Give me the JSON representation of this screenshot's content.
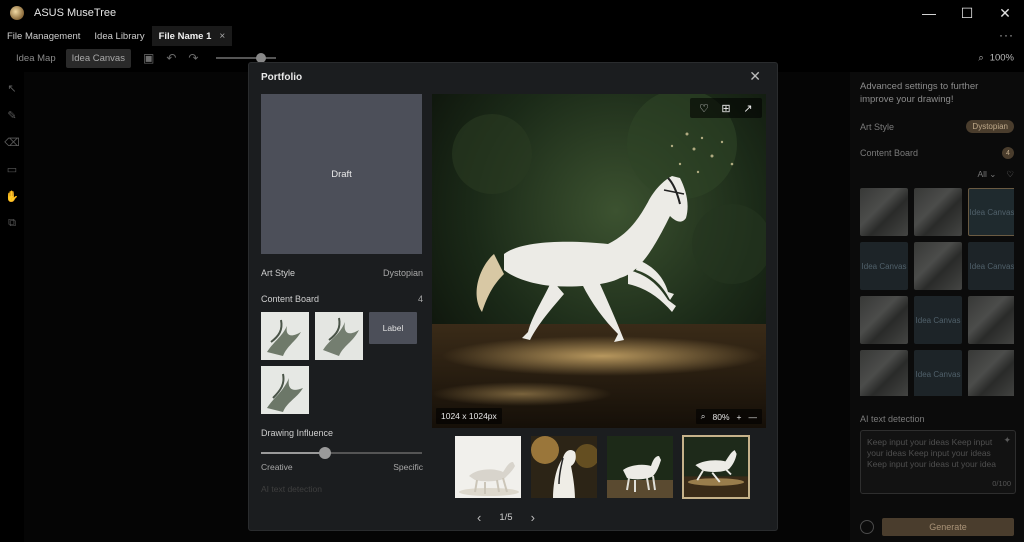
{
  "app": {
    "title": "ASUS MuseTree",
    "window_controls": [
      "—",
      "☐",
      "✕"
    ]
  },
  "tabs": {
    "items": [
      {
        "label": "File Management"
      },
      {
        "label": "Idea Library"
      },
      {
        "label": "File Name 1",
        "close": "×"
      }
    ],
    "more": "···"
  },
  "toolbar": {
    "idea_map": "Idea Map",
    "idea_canvas": "Idea Canvas",
    "zoom": "100%"
  },
  "right_panel": {
    "heading": "Advanced settings to further improve your drawing!",
    "art_style_label": "Art Style",
    "art_style_value": "Dystopian",
    "content_board_label": "Content Board",
    "content_board_count": "4",
    "filter": "All",
    "grid": [
      {
        "type": "thumb"
      },
      {
        "type": "thumb"
      },
      {
        "type": "label",
        "text": "Idea Canvas",
        "selected": true
      },
      {
        "type": "label",
        "text": "Idea Canvas"
      },
      {
        "type": "thumb"
      },
      {
        "type": "label",
        "text": "Idea Canvas"
      },
      {
        "type": "thumb"
      },
      {
        "type": "label",
        "text": "Idea Canvas"
      },
      {
        "type": "thumb"
      },
      {
        "type": "thumb"
      },
      {
        "type": "label",
        "text": "Idea Canvas"
      },
      {
        "type": "thumb"
      },
      {
        "type": "thumb"
      },
      {
        "type": "thumb"
      },
      {
        "type": "label",
        "text": "Idea"
      }
    ],
    "ai_section": "AI text detection",
    "textarea": "Keep input your ideas Keep input your ideas Keep input your ideas Keep input your ideas ut your idea",
    "counter": "0/100",
    "generate": "Generate"
  },
  "dialog": {
    "title": "Portfolio",
    "draft": "Draft",
    "art_style_label": "Art Style",
    "art_style_value": "Dystopian",
    "content_board_label": "Content Board",
    "content_board_count": "4",
    "content_label_tile": "Label",
    "drawing_influence": "Drawing Influence",
    "influence_value": 0.4,
    "influence_low": "Creative",
    "influence_high": "Specific",
    "faded_next_section": "AI text detection",
    "image_size": "1024 x 1024px",
    "image_zoom": "80%",
    "pager": "1/5",
    "selected_thumb": 4
  },
  "colors": {
    "accent": "#c6b28a",
    "dialog_bg": "#1b1d1f",
    "draft_tile": "#4c4f59"
  }
}
